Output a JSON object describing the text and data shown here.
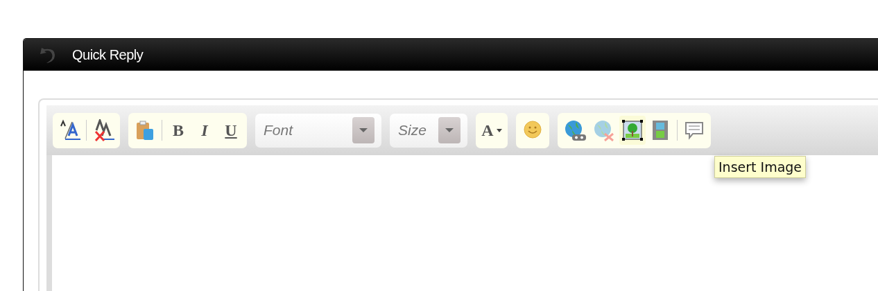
{
  "window": {
    "title": "Quick Reply"
  },
  "toolbar": [
    {
      "kind": "group",
      "buttons": [
        {
          "kind": "resize",
          "hovered": false,
          "disabled": false
        },
        {
          "kind": "divider"
        },
        {
          "kind": "clear",
          "hovered": false,
          "disabled": false
        }
      ]
    },
    {
      "kind": "group",
      "buttons": [
        {
          "kind": "paste",
          "hovered": false,
          "disabled": false
        },
        {
          "kind": "divider"
        },
        {
          "kind": "bold",
          "label": "B",
          "hovered": false,
          "disabled": false
        },
        {
          "kind": "italic",
          "label": "I",
          "hovered": false,
          "disabled": false
        },
        {
          "kind": "underline",
          "label": "U",
          "hovered": false,
          "disabled": false
        }
      ]
    },
    {
      "kind": "select",
      "placeholder": "Font",
      "wide": true
    },
    {
      "kind": "select",
      "placeholder": "Size",
      "wide": false
    },
    {
      "kind": "group",
      "buttons": [
        {
          "kind": "color",
          "label": "A",
          "hovered": false,
          "disabled": false
        }
      ]
    },
    {
      "kind": "group",
      "buttons": [
        {
          "kind": "smiley",
          "hovered": false,
          "disabled": false
        }
      ]
    },
    {
      "kind": "group",
      "buttons": [
        {
          "kind": "link",
          "hovered": false,
          "disabled": false
        },
        {
          "kind": "unlink",
          "hovered": false,
          "disabled": true
        },
        {
          "kind": "image",
          "hovered": true,
          "disabled": false
        },
        {
          "kind": "video",
          "hovered": false,
          "disabled": false
        },
        {
          "kind": "divider"
        },
        {
          "kind": "quote",
          "hovered": false,
          "disabled": false
        }
      ]
    }
  ],
  "tooltip": {
    "text": "Insert Image"
  }
}
